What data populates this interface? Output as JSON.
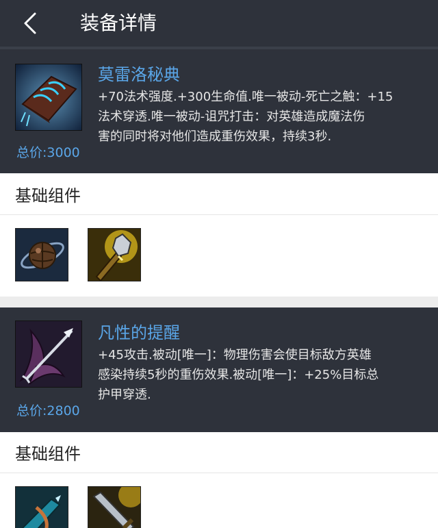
{
  "header": {
    "back_icon": "chevron-left-icon",
    "title": "装备详情"
  },
  "items": [
    {
      "name": "莫雷洛秘典",
      "description": "+70法术强度.+300生命值.唯一被动-死亡之触：+15\n法术穿透.唯一被动-诅咒打击：对英雄造成魔法伤\n害的同时将对他们造成重伤效果，持续3秒.",
      "price": "总价:3000",
      "icon": "cursed-tome-icon",
      "section_title": "基础组件",
      "components": [
        "orb-amulet-icon",
        "golden-scepter-icon"
      ]
    },
    {
      "name": "凡性的提醒",
      "description": "+45攻击.被动[唯一]：物理伤害会使目标敌方英雄\n感染持续5秒的重伤效果.被动[唯一]：+25%目标总\n护甲穿透.",
      "price": "总价:2800",
      "icon": "mortal-reminder-icon",
      "section_title": "基础组件",
      "components": [
        "teal-crossbow-icon",
        "steel-sword-icon"
      ]
    }
  ],
  "colors": {
    "card_bg": "#2e323b",
    "accent_blue": "#5aa6e8",
    "desc_text": "#e6e6e6"
  }
}
